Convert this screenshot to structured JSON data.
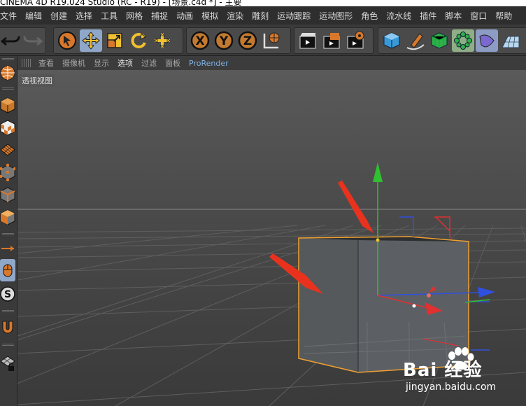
{
  "window": {
    "title": "CINEMA 4D R19.024 Studio (RC - R19) - [场景.c4d *] - 主要"
  },
  "menu": {
    "items": [
      "文件",
      "编辑",
      "创建",
      "选择",
      "工具",
      "网格",
      "捕捉",
      "动画",
      "模拟",
      "渲染",
      "雕刻",
      "运动跟踪",
      "运动图形",
      "角色",
      "流水线",
      "插件",
      "脚本",
      "窗口",
      "帮助"
    ]
  },
  "toolbar": {
    "buttons": [
      {
        "icon": "undo-icon"
      },
      {
        "icon": "redo-icon"
      },
      {
        "icon": "live-select-icon"
      },
      {
        "icon": "move-icon"
      },
      {
        "icon": "scale-icon"
      },
      {
        "icon": "rotate-icon"
      },
      {
        "icon": "last-tool-icon"
      },
      {
        "icon": "x-axis-lock-icon",
        "label": "X"
      },
      {
        "icon": "y-axis-lock-icon",
        "label": "Y"
      },
      {
        "icon": "z-axis-lock-icon",
        "label": "Z"
      },
      {
        "icon": "coordinate-system-icon"
      },
      {
        "icon": "render-view-icon"
      },
      {
        "icon": "render-to-picture-viewer-icon"
      },
      {
        "icon": "render-settings-icon"
      },
      {
        "icon": "cube-icon"
      },
      {
        "icon": "pen-spline-icon"
      },
      {
        "icon": "subdivision-surface-icon"
      },
      {
        "icon": "array-icon"
      },
      {
        "icon": "deformer-icon"
      },
      {
        "icon": "floor-icon"
      }
    ]
  },
  "left_palette": {
    "buttons": [
      "make-editable-icon",
      "model-mode-icon",
      "texture-mode-icon",
      "workplane-icon",
      "points-mode-icon",
      "edges-mode-icon",
      "polygons-mode-icon",
      "axis-mode-icon",
      "tweak-mode-icon",
      "solo-icon",
      "snap-magnet-icon",
      "locked-workplane-icon"
    ]
  },
  "viewport": {
    "menu": [
      "查看",
      "摄像机",
      "显示",
      "选项",
      "过滤",
      "面板",
      "ProRender"
    ],
    "highlighted": "选项",
    "label": "透视视图",
    "colors": {
      "background": "#4a4a4a",
      "grid": "#5a5a5a",
      "selection_outline": "#f0a030",
      "axis_x": "#e03030",
      "axis_y": "#30c030",
      "axis_z": "#3050e0",
      "annotation_arrow": "#e8321e"
    }
  },
  "watermark": {
    "brand": "Bai 经验",
    "url": "jingyan.baidu.com"
  }
}
